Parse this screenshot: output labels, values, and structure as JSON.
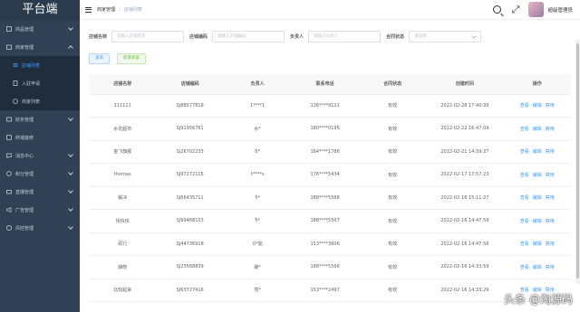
{
  "sidebar": {
    "logo": "平台端",
    "items": [
      {
        "label": "商品管理"
      },
      {
        "label": "商家管理"
      }
    ],
    "sub_items": [
      {
        "label": "店铺列表"
      },
      {
        "label": "入驻申请"
      },
      {
        "label": "商家列表"
      }
    ],
    "items_after": [
      {
        "label": "财务管理"
      },
      {
        "label": "终端装修"
      },
      {
        "label": "消息中心"
      },
      {
        "label": "积分管理"
      },
      {
        "label": "直播管理"
      },
      {
        "label": "广告管理"
      },
      {
        "label": "风控管理"
      }
    ]
  },
  "header": {
    "breadcrumb_parent": "商家管理",
    "breadcrumb_sep": "/",
    "breadcrumb_current": "店铺列表",
    "user_name": "超级管理员"
  },
  "filter": {
    "shop_name_label": "店铺名称",
    "shop_name_placeholder": "请输入店铺名称",
    "shop_code_label": "店铺编码",
    "shop_code_placeholder": "请输入店铺编码",
    "owner_label": "负责人",
    "owner_placeholder": "请输入负责人",
    "contract_label": "合同状态",
    "contract_placeholder": "请选择"
  },
  "buttons": {
    "query": "查询",
    "new_merchant": "新建商家"
  },
  "table": {
    "headers": [
      "店铺名称",
      "店铺编码",
      "负责人",
      "联系电话",
      "合同状态",
      "创建时间",
      "操作"
    ],
    "ops": [
      "查看",
      "编辑",
      "禁用"
    ],
    "rows": [
      {
        "name": "111111",
        "code": "SJ88577819",
        "owner": "1****1",
        "phone": "136****9111",
        "status": "有效",
        "time": "2022-02-28 17:40:39"
      },
      {
        "name": "水花超市",
        "code": "SJ91956761",
        "owner": "水*",
        "phone": "180****0195",
        "status": "有效",
        "time": "2022-02-22 16:47:09"
      },
      {
        "name": "金飞旗舰",
        "code": "SJ26702233",
        "owner": "5*",
        "phone": "184****1786",
        "status": "有效",
        "time": "2022-02-21 14:39:37"
      },
      {
        "name": "thomas",
        "code": "SJ97272115",
        "owner": "t****s",
        "phone": "176****5434",
        "status": "有效",
        "time": "2022-02-17 17:57:23"
      },
      {
        "name": "解决",
        "code": "SJ66435711",
        "owner": "5*",
        "phone": "188****5568",
        "status": "有效",
        "time": "2022-02-16 15:11:27"
      },
      {
        "name": "快快快",
        "code": "SJ99468153",
        "owner": "5*",
        "phone": "188****5567",
        "status": "有效",
        "time": "2022-02-16 14:47:59"
      },
      {
        "name": "硕行",
        "code": "SJ44736918",
        "owner": "O*能",
        "phone": "153****3606",
        "status": "有效",
        "time": "2022-02-16 14:47:56"
      },
      {
        "name": "朗皓",
        "code": "SJ23568839",
        "owner": "朗*",
        "phone": "188****5566",
        "status": "有效",
        "time": "2022-02-16 14:33:59"
      },
      {
        "name": "比较起来",
        "code": "SJ63727416",
        "owner": "亮*",
        "phone": "153****2497",
        "status": "有效",
        "time": "2022-02-16 14:33:29"
      }
    ]
  },
  "watermark": "头条 @淘源码"
}
